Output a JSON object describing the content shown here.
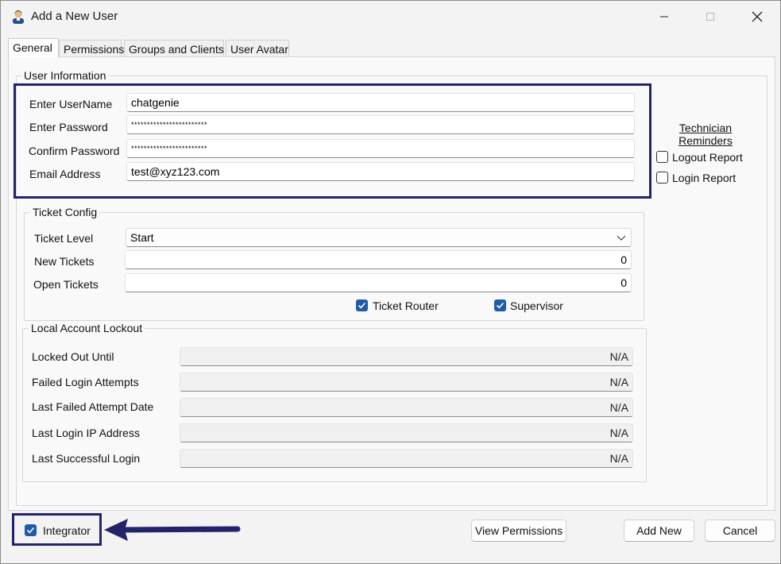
{
  "window": {
    "title": "Add a New User",
    "icon": "user-icon",
    "controls": {
      "minimize": "minimize-icon",
      "maximize": "maximize-icon",
      "close": "close-icon"
    }
  },
  "tabs": [
    {
      "label": "General",
      "active": true
    },
    {
      "label": "Permissions",
      "active": false
    },
    {
      "label": "Groups and Clients",
      "active": false
    },
    {
      "label": "User Avatar",
      "active": false
    }
  ],
  "user_info": {
    "legend": "User Information",
    "username_label": "Enter UserName",
    "username_value": "chatgenie",
    "password_label": "Enter Password",
    "password_value": "************************",
    "confirm_label": "Confirm Password",
    "confirm_value": "************************",
    "email_label": "Email Address",
    "email_value": "test@xyz123.com"
  },
  "technician_reminders": {
    "title_line1": "Technician",
    "title_line2": "Reminders",
    "logout_report": {
      "label": "Logout Report",
      "checked": false
    },
    "login_report": {
      "label": "Login Report",
      "checked": false
    }
  },
  "ticket_config": {
    "legend": "Ticket Config",
    "level_label": "Ticket Level",
    "level_value": "Start",
    "new_label": "New Tickets",
    "new_value": "0",
    "open_label": "Open Tickets",
    "open_value": "0",
    "router": {
      "label": "Ticket Router",
      "checked": true
    },
    "supervisor": {
      "label": "Supervisor",
      "checked": true
    }
  },
  "lockout": {
    "legend": "Local Account Lockout",
    "rows": [
      {
        "label": "Locked Out Until",
        "value": "N/A"
      },
      {
        "label": "Failed Login Attempts",
        "value": "N/A"
      },
      {
        "label": "Last Failed Attempt Date",
        "value": "N/A"
      },
      {
        "label": "Last Login IP Address",
        "value": "N/A"
      },
      {
        "label": "Last Successful Login",
        "value": "N/A"
      }
    ]
  },
  "footer": {
    "integrator": {
      "label": "Integrator",
      "checked": true
    },
    "view_permissions": "View Permissions",
    "add_new": "Add New",
    "cancel": "Cancel"
  },
  "colors": {
    "annotation": "#23236b",
    "checkbox_checked": "#1f5ca8"
  }
}
